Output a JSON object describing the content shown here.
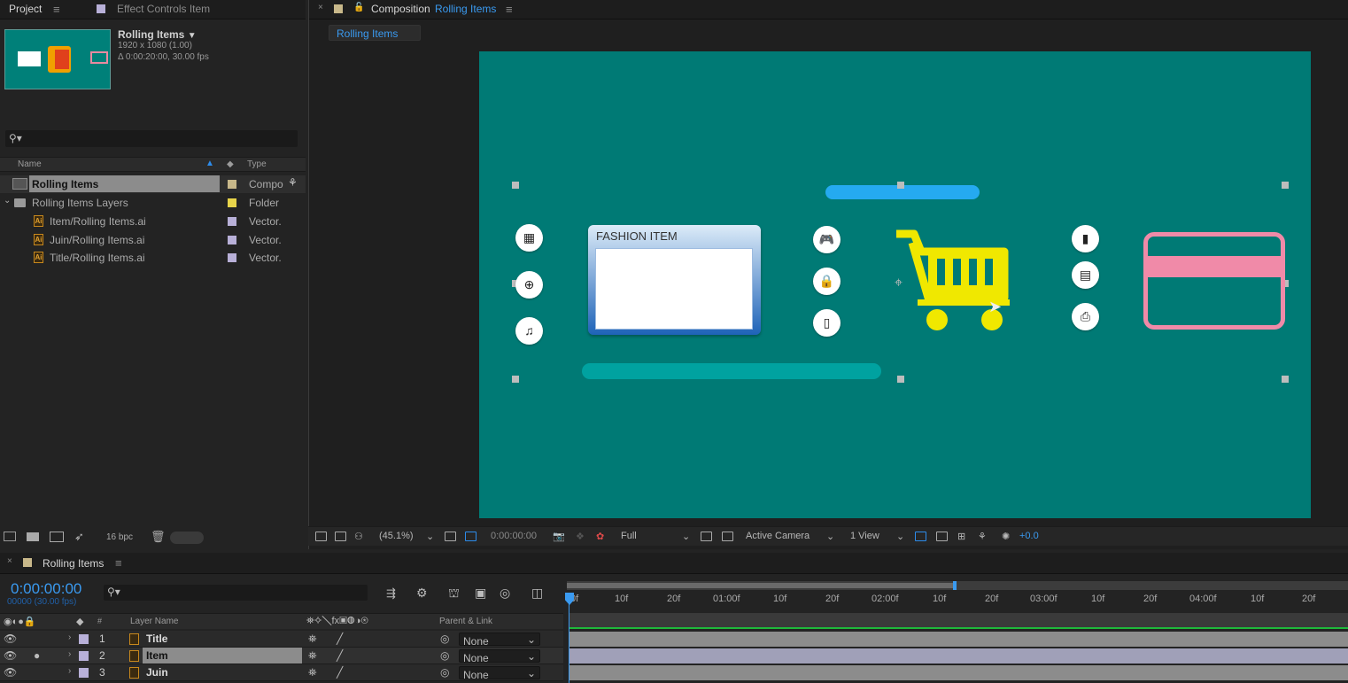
{
  "project_panel": {
    "tab_project": "Project",
    "tab_effect_controls": "Effect Controls Item",
    "comp_name": "Rolling Items",
    "comp_resolution": "1920 x 1080 (1.00)",
    "comp_duration": "Δ 0:00:20:00, 30.00 fps",
    "search_placeholder": "",
    "col_name": "Name",
    "col_type": "Type",
    "items": [
      {
        "name": "Rolling Items",
        "type": "Compo",
        "label_color": "#c8b88a"
      },
      {
        "name": "Rolling Items Layers",
        "type": "Folder",
        "label_color": "#e8d44a"
      },
      {
        "name": "Item/Rolling Items.ai",
        "type": "Vector.",
        "label_color": "#b8b0d8"
      },
      {
        "name": "Juin/Rolling Items.ai",
        "type": "Vector.",
        "label_color": "#b8b0d8"
      },
      {
        "name": "Title/Rolling Items.ai",
        "type": "Vector.",
        "label_color": "#b8b0d8"
      }
    ],
    "footer_bpc": "16 bpc"
  },
  "composition_panel": {
    "tab_prefix": "Composition",
    "tab_comp_name": "Rolling Items",
    "breadcrumb": "Rolling Items",
    "canvas": {
      "background": "#007a75",
      "fashion_title": "FASHION ITEM",
      "left_icons": [
        "calendar-icon",
        "globe-icon",
        "music-icon"
      ],
      "mid_icons": [
        "gamepad-icon",
        "lock-icon",
        "film-icon"
      ],
      "right_icons": [
        "phone-icon",
        "calculator-icon",
        "printer-icon"
      ]
    },
    "viewer": {
      "zoom": "(45.1%)",
      "timecode": "0:00:00:00",
      "resolution": "Full",
      "camera": "Active Camera",
      "views": "1 View",
      "exposure": "+0.0"
    }
  },
  "timeline": {
    "tab": "Rolling Items",
    "timecode": "0:00:00:00",
    "frames": "00000 (30.00 fps)",
    "col_layer_name": "Layer Name",
    "col_parent": "Parent & Link",
    "ruler": [
      "0f",
      "10f",
      "20f",
      "01:00f",
      "10f",
      "20f",
      "02:00f",
      "10f",
      "20f",
      "03:00f",
      "10f",
      "20f",
      "04:00f",
      "10f",
      "20f"
    ],
    "layers": [
      {
        "num": "1",
        "name": "Title",
        "parent": "None"
      },
      {
        "num": "2",
        "name": "Item",
        "parent": "None"
      },
      {
        "num": "3",
        "name": "Juin",
        "parent": "None"
      }
    ]
  }
}
